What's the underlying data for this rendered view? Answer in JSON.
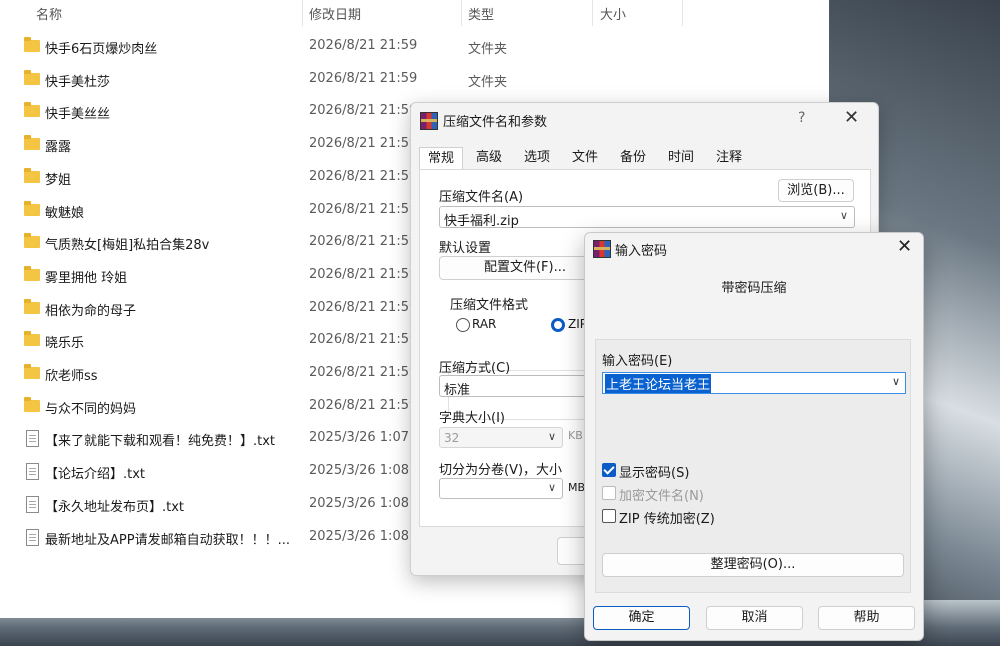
{
  "explorer": {
    "columns": {
      "name": "名称",
      "date": "修改日期",
      "type": "类型",
      "size": "大小"
    },
    "rows": [
      {
        "name": "快手6石页爆炒肉丝",
        "date": "2026/8/21 21:59",
        "type": "文件夹",
        "icon": "folder-icon"
      },
      {
        "name": "快手美杜莎",
        "date": "2026/8/21 21:59",
        "type": "文件夹",
        "icon": "folder-icon"
      },
      {
        "name": "快手美丝丝",
        "date": "2026/8/21 21:59",
        "type": "",
        "icon": "folder-icon"
      },
      {
        "name": "露露",
        "date": "2026/8/21 21:59",
        "type": "",
        "icon": "folder-icon"
      },
      {
        "name": "梦姐",
        "date": "2026/8/21 21:59",
        "type": "",
        "icon": "folder-icon"
      },
      {
        "name": "敏魅娘",
        "date": "2026/8/21 21:59",
        "type": "",
        "icon": "folder-icon"
      },
      {
        "name": "气质熟女[梅姐]私拍合集28v",
        "date": "2026/8/21 21:59",
        "type": "",
        "icon": "folder-icon"
      },
      {
        "name": "雾里拥他 玲姐",
        "date": "2026/8/21 21:59",
        "type": "",
        "icon": "folder-icon"
      },
      {
        "name": "相依为命的母子",
        "date": "2026/8/21 21:59",
        "type": "",
        "icon": "folder-icon"
      },
      {
        "name": "晓乐乐",
        "date": "2026/8/21 21:59",
        "type": "",
        "icon": "folder-icon"
      },
      {
        "name": "欣老师ss",
        "date": "2026/8/21 21:59",
        "type": "",
        "icon": "folder-icon"
      },
      {
        "name": "与众不同的妈妈",
        "date": "2026/8/21 21:59",
        "type": "",
        "icon": "folder-icon"
      },
      {
        "name": "【来了就能下载和观看！纯免费！】.txt",
        "date": "2025/3/26 1:07",
        "type": "",
        "icon": "text-file-icon"
      },
      {
        "name": "【论坛介绍】.txt",
        "date": "2025/3/26 1:08",
        "type": "",
        "icon": "text-file-icon"
      },
      {
        "name": "【永久地址发布页】.txt",
        "date": "2025/3/26 1:08",
        "type": "",
        "icon": "text-file-icon"
      },
      {
        "name": "最新地址及APP请发邮箱自动获取！！！...",
        "date": "2025/3/26 1:08",
        "type": "",
        "icon": "text-file-icon"
      }
    ]
  },
  "archive_dialog": {
    "title": "压缩文件名和参数",
    "help": "?",
    "close": "✕",
    "tabs": [
      "常规",
      "高级",
      "选项",
      "文件",
      "备份",
      "时间",
      "注释"
    ],
    "archive_name_label": "压缩文件名(A)",
    "browse_button": "浏览(B)...",
    "archive_name_value": "快手福利.zip",
    "default_settings_label": "默认设置",
    "profiles_button": "配置文件(F)...",
    "format_label": "压缩文件格式",
    "format_rar": "RAR",
    "format_zip": "ZIP",
    "method_label": "压缩方式(C)",
    "method_value": "标准",
    "dict_label": "字典大小(I)",
    "dict_value": "32",
    "dict_unit": "KB",
    "split_label": "切分为分卷(V)，大小",
    "split_unit": "MB"
  },
  "password_dialog": {
    "title": "输入密码",
    "close": "✕",
    "subtitle": "带密码压缩",
    "password_label": "输入密码(E)",
    "password_value": "上老王论坛当老王",
    "show_password": "显示密码(S)",
    "show_password_checked": true,
    "encrypt_names": "加密文件名(N)",
    "zip_legacy": "ZIP 传统加密(Z)",
    "organize_button": "整理密码(O)...",
    "ok_button": "确定",
    "cancel_button": "取消",
    "help_button": "帮助"
  }
}
